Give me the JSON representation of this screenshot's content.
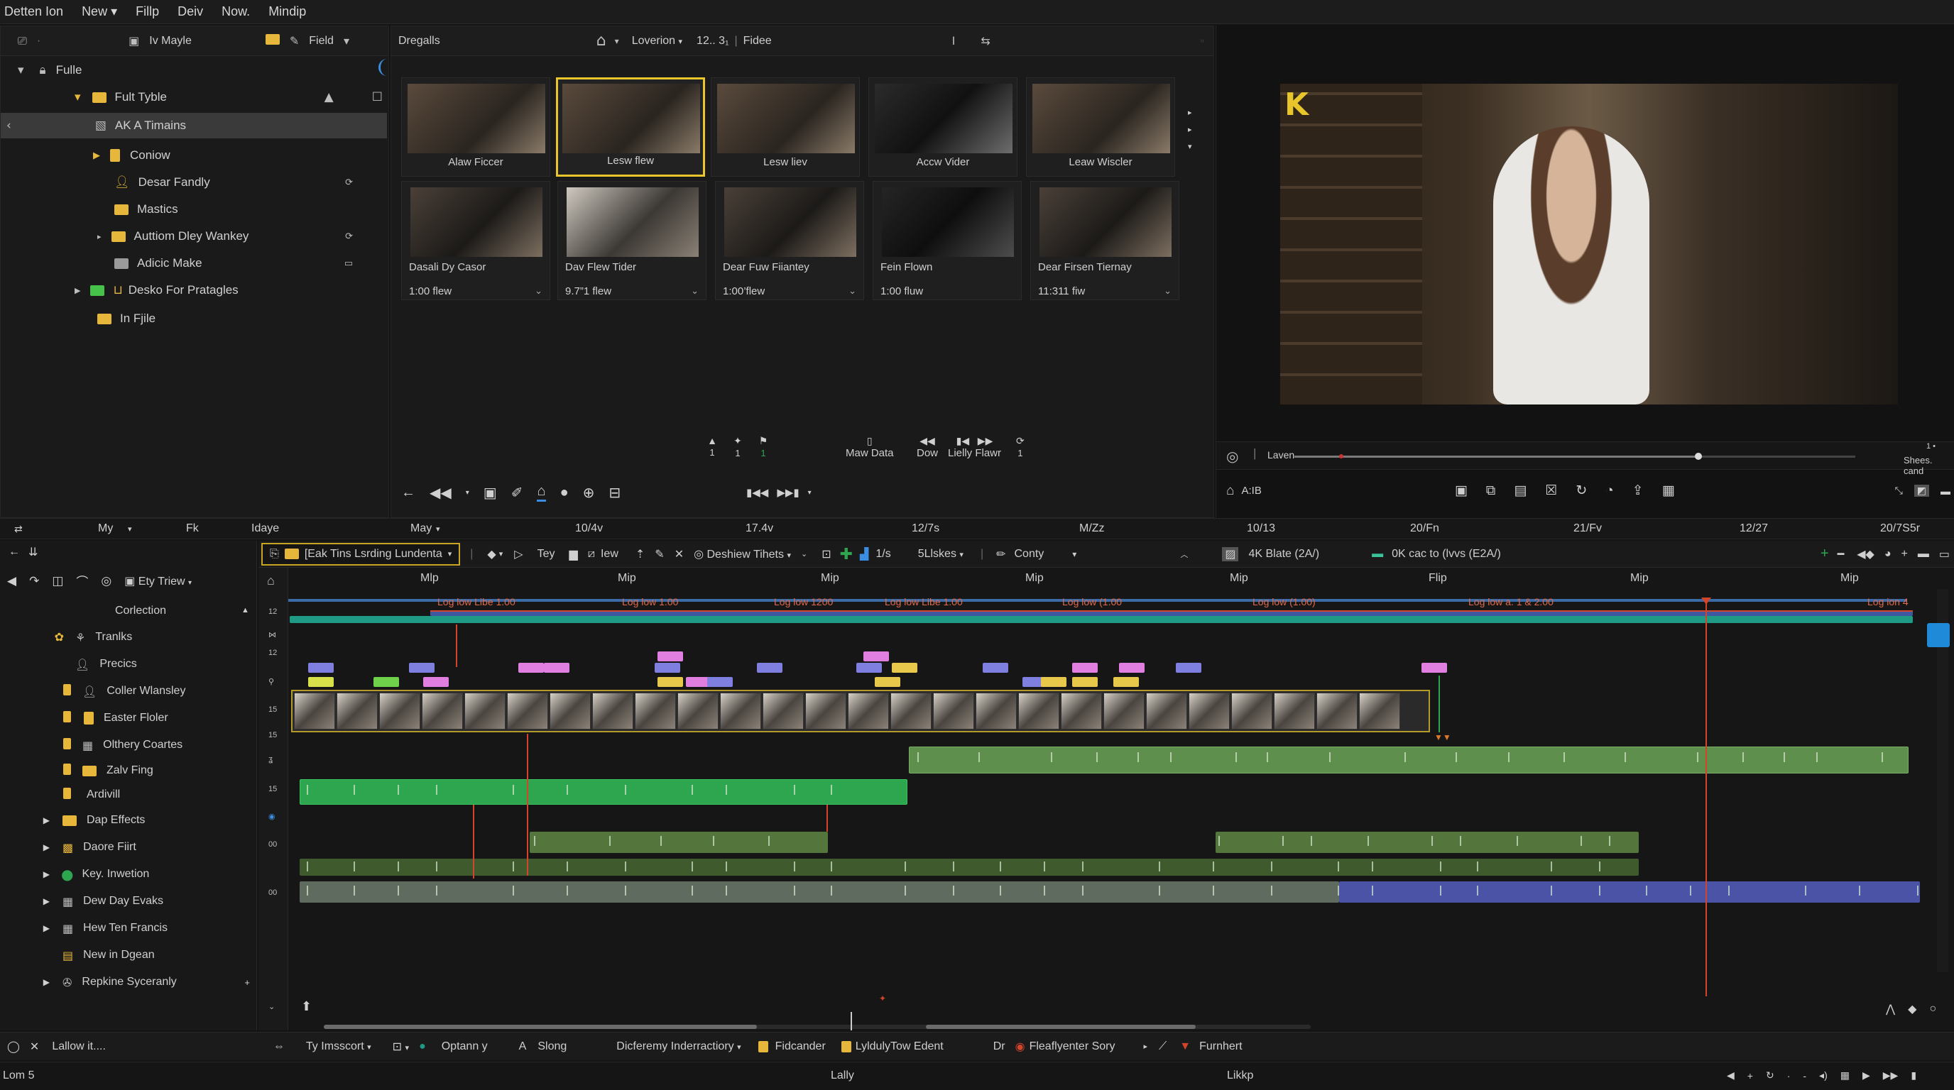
{
  "menu": [
    "Detten Ion",
    "New",
    "Fillp",
    "Deiv",
    "Now.",
    "Mindip"
  ],
  "browser": {
    "tabs": [
      "Iv Mayle",
      "Field"
    ],
    "items": [
      {
        "label": "Fulle",
        "icon": "lock-icon"
      },
      {
        "label": "Fult Tyble",
        "icon": "folder-icon"
      },
      {
        "label": "AK A Timains",
        "icon": "image-icon",
        "selected": true
      },
      {
        "label": "Coniow",
        "icon": "folder-icon"
      },
      {
        "label": "Desar Fandly",
        "icon": "user-icon"
      },
      {
        "label": "Mastics",
        "icon": "folder-icon"
      },
      {
        "label": "Auttiom Dley Wankey",
        "icon": "folder-icon"
      },
      {
        "label": "Adicic Make",
        "icon": "folder-icon"
      },
      {
        "label": "Desko For Pratagles",
        "icon": "folder-icon"
      },
      {
        "label": "In Fjile",
        "icon": "folder-icon"
      }
    ]
  },
  "media": {
    "title": "Dregalls",
    "toolbar": {
      "view": "Loverion",
      "counter": "12.. 3₁",
      "mode": "Fidee"
    },
    "row1": [
      {
        "label": "Alaw Ficcer"
      },
      {
        "label": "Lesw flew",
        "selected": true
      },
      {
        "label": "Lesw liev"
      },
      {
        "label": "Accw Vider"
      },
      {
        "label": "Leaw Wiscler"
      }
    ],
    "row2": [
      {
        "title": "Dasali Dy Casor",
        "dur": "1:00 flew"
      },
      {
        "title": "Dav Flew Tider",
        "dur": "9.7”1 flew"
      },
      {
        "title": "Dear Fuw Fiiantey",
        "dur": "1:00’flew"
      },
      {
        "title": "Fein Flown",
        "dur": "1:00 fluw"
      },
      {
        "title": "Dear Firsen Tiernay",
        "dur": "11:311 fiw"
      }
    ],
    "controls": {
      "c1": "1",
      "c2": "1",
      "c3": "1",
      "make": "Maw Data",
      "dow": "Dow",
      "flaw": "Lielly Flawr",
      "extra": "1"
    }
  },
  "viewer": {
    "badge": "K",
    "scrub_label": "Laven",
    "scrub_progress": 0.72,
    "tc": "A:IB",
    "right1": "1 •",
    "right2": "Shees. cand"
  },
  "timeline": {
    "ruler": [
      "My",
      "Fk",
      "Idaye",
      "May",
      "10/4v",
      "17.4v",
      "12/7s",
      "M/Zz",
      "10/13",
      "20/Fn",
      "21/Fv",
      "12/27",
      "20/7S5r"
    ],
    "toolbar": {
      "project": "[Eak Tins Lsrding Lundenta",
      "t1": "Tey",
      "t2": "Iew",
      "t3": "Deshiew Tihets",
      "t4": "1/s",
      "t5": "5Llskes",
      "t6": "Conty",
      "preset1": "4K Blate (2A/)",
      "preset2": "0K cac to (lvvs (E2A/)"
    },
    "clip_headers": [
      "Mlp",
      "Mip",
      "Mip",
      "Mip",
      "Mip",
      "Flip",
      "Mip",
      "Mip"
    ],
    "marker_labels": [
      "Log low Libe 1.00",
      "Log low 1.00",
      "Log low 1200",
      "Log low Libe 1.00",
      "Log low (1.00",
      "Log low (1.00)",
      "Log low a. 1 & 2.00",
      "Log ion 4"
    ],
    "track_numbers": [
      "12",
      "15",
      "15",
      "15",
      "15",
      "15",
      "00",
      "00"
    ]
  },
  "effects": {
    "filter": "Ety Triew",
    "header": "Corlection",
    "items": [
      {
        "label": "Tranlks",
        "icon": "user-icon"
      },
      {
        "label": "Precics",
        "icon": "user-icon"
      },
      {
        "label": "Coller Wlansley",
        "icon": "user-icon"
      },
      {
        "label": "Easter Floler",
        "icon": "square-icon"
      },
      {
        "label": "Olthery Coartes",
        "icon": "film-icon"
      },
      {
        "label": "Zalv Fing",
        "icon": "folder-icon"
      },
      {
        "label": "Ardivill",
        "icon": "none"
      },
      {
        "label": "Dap Effects",
        "icon": "film-icon"
      },
      {
        "label": "Daore Fiirt",
        "icon": "film-icon"
      },
      {
        "label": "Key. Inwetion",
        "icon": "circle-icon"
      },
      {
        "label": "Dew Day Evaks",
        "icon": "film-icon"
      },
      {
        "label": "Hew Ten Francis",
        "icon": "film-icon"
      },
      {
        "label": "New in Dgean",
        "icon": "doc-icon"
      },
      {
        "label": "Repkine Syceranly",
        "icon": "film-icon"
      }
    ]
  },
  "bottombar": {
    "left": "Lallow it....",
    "items": [
      "Ty Imsscort",
      "Optann y",
      "Slong",
      "Dicferemy Inderractiory",
      "Fidcander",
      "LyldulyTow Edent",
      "Dr",
      "Fleaflyenter Sory",
      "Furnhert"
    ]
  },
  "statusbar": {
    "left": "Lom 5",
    "center": "Lally",
    "center2": "Likkp"
  },
  "colors": {
    "accent": "#e7c52b",
    "green_clip": "#2ea64f",
    "olive_clip": "#4c6a2e",
    "blue_clip": "#4b53a6",
    "playhead": "#d2452b"
  }
}
